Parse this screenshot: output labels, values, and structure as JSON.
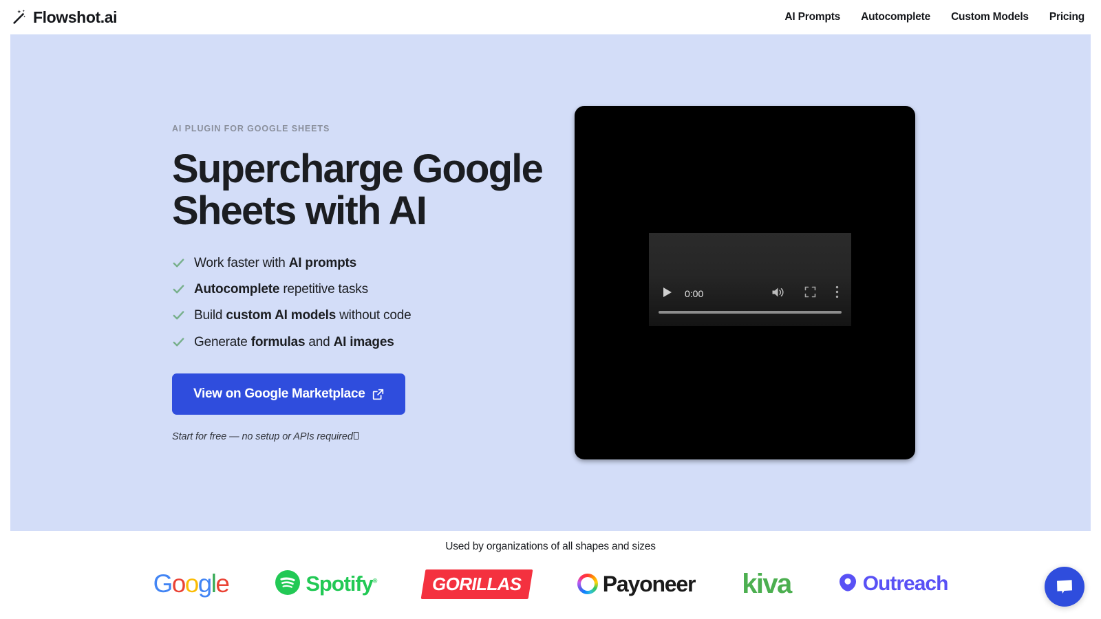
{
  "header": {
    "brand_name": "Flowshot.ai",
    "brand_icon": "magic-wand-icon",
    "nav": [
      {
        "label": "AI Prompts"
      },
      {
        "label": "Autocomplete"
      },
      {
        "label": "Custom Models"
      },
      {
        "label": "Pricing"
      }
    ]
  },
  "hero": {
    "eyebrow": "AI PLUGIN FOR GOOGLE SHEETS",
    "title": "Supercharge Google Sheets with AI",
    "features": [
      {
        "icon": "check-icon",
        "pre": "Work faster with ",
        "bold": "AI prompts",
        "post": ""
      },
      {
        "icon": "check-icon",
        "pre": "",
        "bold": "Autocomplete",
        "post": " repetitive tasks"
      },
      {
        "icon": "check-icon",
        "pre": "Build ",
        "bold": "custom AI models",
        "post": " without code"
      },
      {
        "icon": "check-icon",
        "pre": "Generate ",
        "bold": "formulas",
        "post": " and ",
        "bold2": "AI images"
      }
    ],
    "cta_label": "View on Google Marketplace",
    "cta_icon": "external-link-icon",
    "cta_note": "Start for free — no setup or APIs required",
    "background_color": "#d3ddf8",
    "accent_color": "#2f4ddd",
    "check_color": "#78b08c"
  },
  "video": {
    "current_time": "0:00",
    "play_icon": "play-icon",
    "volume_icon": "volume-icon",
    "fullscreen_icon": "fullscreen-icon",
    "more_icon": "kebab-menu-icon",
    "scrubber": "progress-scrubber"
  },
  "logos": {
    "caption": "Used by organizations of all shapes and sizes",
    "items": [
      {
        "name": "Google",
        "g1": "G",
        "g2": "o",
        "g3": "o",
        "g4": "g",
        "g5": "l",
        "g6": "e"
      },
      {
        "name": "Spotify",
        "word": "Spotify",
        "tm": "®",
        "color": "#22c955"
      },
      {
        "name": "Gorillas",
        "word": "GORILLAS",
        "color": "#f4313f"
      },
      {
        "name": "Payoneer",
        "word": "Payoneer",
        "color": "#1a1a1a"
      },
      {
        "name": "kiva",
        "word": "kiva",
        "color": "#4caf50"
      },
      {
        "name": "Outreach",
        "word": "Outreach",
        "color": "#5951f5"
      }
    ]
  },
  "chat": {
    "icon": "chat-bubble-icon",
    "color": "#2f4ddd"
  }
}
